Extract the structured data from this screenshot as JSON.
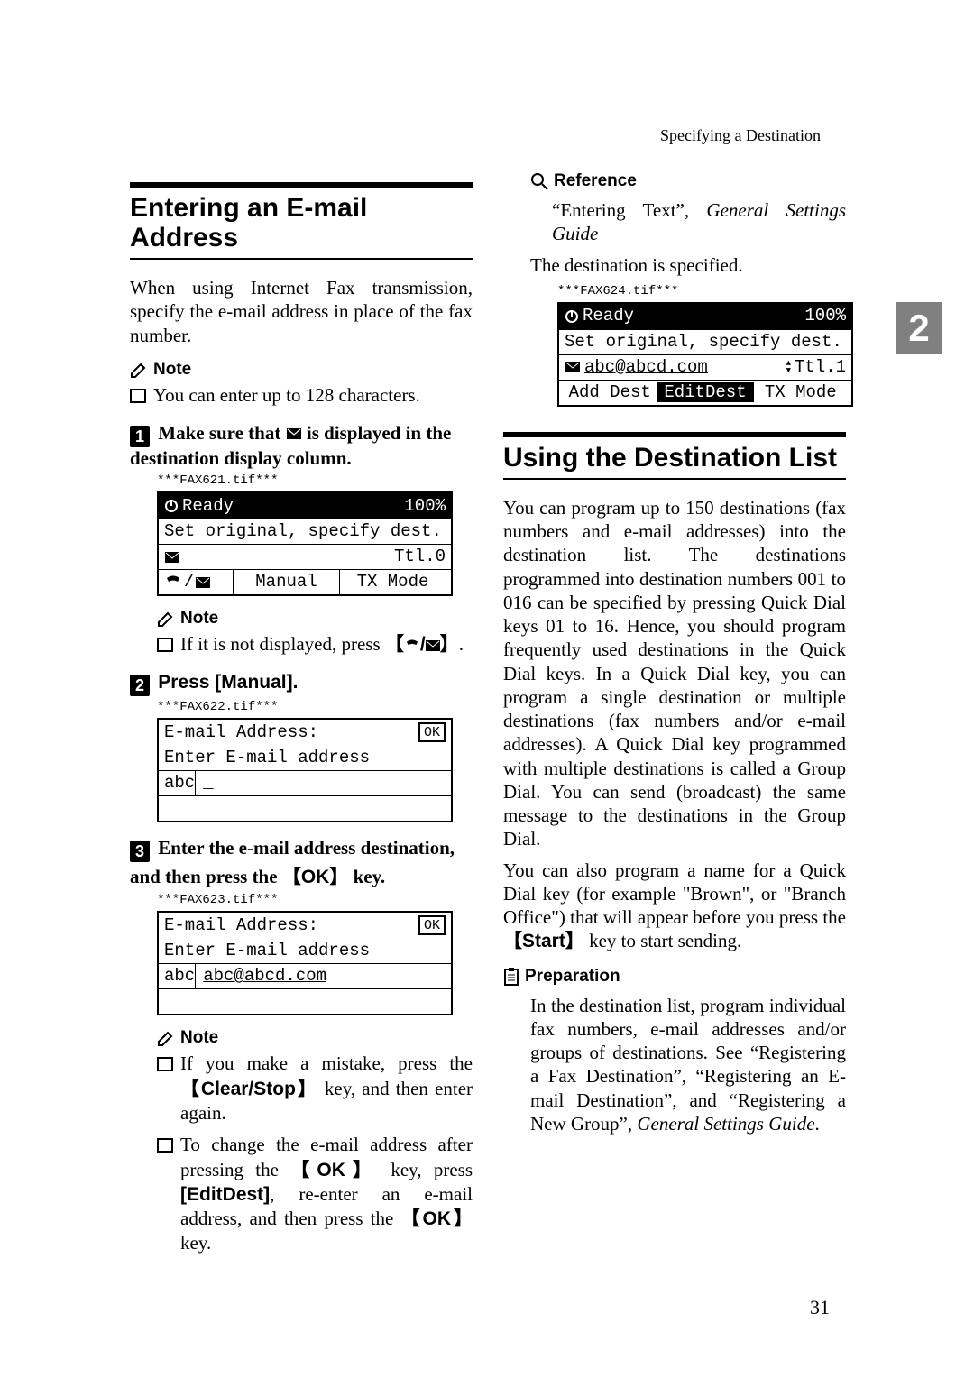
{
  "running_head": "Specifying a Destination",
  "side_tab": "2",
  "page_number": "31",
  "left": {
    "h2": "Entering an E-mail Address",
    "intro": "When using Internet Fax transmission, specify the e-mail address in place of the fax number.",
    "note1_label": "Note",
    "note1_item": "You can enter up to 128 characters.",
    "step1_num": "1",
    "step1a": "Make sure that ",
    "step1b": " is displayed in the destination display column.",
    "fax621": "***FAX621.tif***",
    "lcd1": {
      "r1a": "Ready",
      "r1b": "100%",
      "r2": "Set original, specify dest.",
      "r3b": "Ttl.0",
      "r4b": "Manual",
      "r4c": "TX Mode"
    },
    "note2_label": "Note",
    "note2a": "If it is not displayed, press ",
    "note2b": ".",
    "step2_num": "2",
    "step2": "Press [Manual].",
    "fax622": "***FAX622.tif***",
    "lcd2": {
      "r1": "E-mail Address:",
      "r1ok": "OK",
      "r2": "Enter E-mail address",
      "r3a": "abc",
      "r3b": "_"
    },
    "step3_num": "3",
    "step3a": "Enter the e-mail address destination, and then press the ",
    "step3key": "OK",
    "step3b": " key.",
    "fax623": "***FAX623.tif***",
    "lcd3": {
      "r1": "E-mail Address:",
      "r1ok": "OK",
      "r2": "Enter E-mail address",
      "r3a": "abc",
      "r3b": "abc@abcd.com"
    },
    "note3_label": "Note",
    "note3_i1a": "If you make a mistake, press the ",
    "note3_i1key": "Clear/Stop",
    "note3_i1b": " key, and then enter again.",
    "note3_i2a": "To change the e-mail address after pressing the ",
    "note3_i2key1": "OK",
    "note3_i2b": " key, press ",
    "note3_i2key2": "[EditDest]",
    "note3_i2c": ", re-enter an e-mail address, and then press the ",
    "note3_i2key3": "OK",
    "note3_i2d": " key."
  },
  "right": {
    "ref_label": "Reference",
    "ref_a": "“Entering Text”, ",
    "ref_b": "General Settings Guide",
    "dest_spec": "The destination is specified.",
    "fax624": "***FAX624.tif***",
    "lcd4": {
      "r1a": "Ready",
      "r1b": "100%",
      "r2": "Set original, specify dest.",
      "r3a": "abc@abcd.com",
      "r3b": "Ttl.1",
      "r4a": "Add Dest",
      "r4b": "EditDest",
      "r4c": "TX Mode"
    },
    "h2": "Using the Destination List",
    "p1": "You can program up to 150 destinations (fax numbers and e-mail addresses) into the destination list. The destinations programmed into destination numbers 001 to 016 can be specified by pressing Quick Dial keys 01 to 16. Hence, you should program frequently used destinations in the Quick Dial keys. In a Quick Dial key, you can program a single destination or multiple destinations (fax numbers and/or e-mail addresses). A Quick Dial key programmed with multiple destinations is called a Group Dial. You can send (broadcast) the same message to the destinations in the Group Dial.",
    "p2a": "You can also program a name for a Quick Dial key (for example \"Brown\", or \"Branch Office\") that will appear before you press the ",
    "p2key": "Start",
    "p2b": " key to start sending.",
    "prep_label": "Preparation",
    "prep_a": "In the destination list, program individual fax numbers, e-mail addresses and/or groups of destinations. See “Registering a Fax Destination”, “Registering an E-mail Destination”, and “Registering a New Group”, ",
    "prep_b": "General Settings Guide",
    "prep_c": "."
  }
}
